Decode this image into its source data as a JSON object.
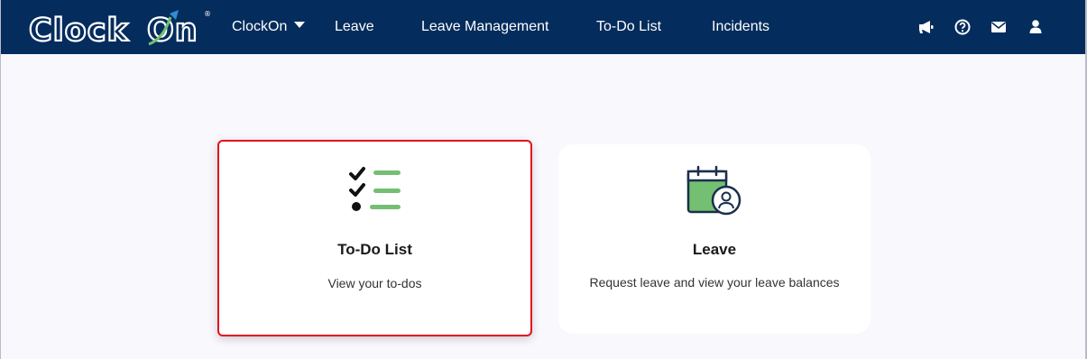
{
  "brand": {
    "logo_text_a": "Clock",
    "logo_text_b": "On",
    "registered": "®"
  },
  "nav": {
    "clockon_menu": "ClockOn",
    "leave": "Leave",
    "leave_management": "Leave Management",
    "todo_list": "To-Do List",
    "incidents": "Incidents"
  },
  "nav_icons": [
    "megaphone-icon",
    "help-icon",
    "mail-icon",
    "user-icon"
  ],
  "cards": [
    {
      "title": "To-Do List",
      "description": "View your to-dos",
      "icon": "todo-checklist-icon",
      "highlighted": true
    },
    {
      "title": "Leave",
      "description": "Request leave and view your leave balances",
      "icon": "calendar-person-icon",
      "highlighted": false
    }
  ],
  "colors": {
    "navbar": "#042c5c",
    "accent_green": "#74bf72",
    "accent_blue": "#2f8fd1",
    "highlight_border": "#e3121c",
    "page_bg": "#f8f8fd"
  }
}
